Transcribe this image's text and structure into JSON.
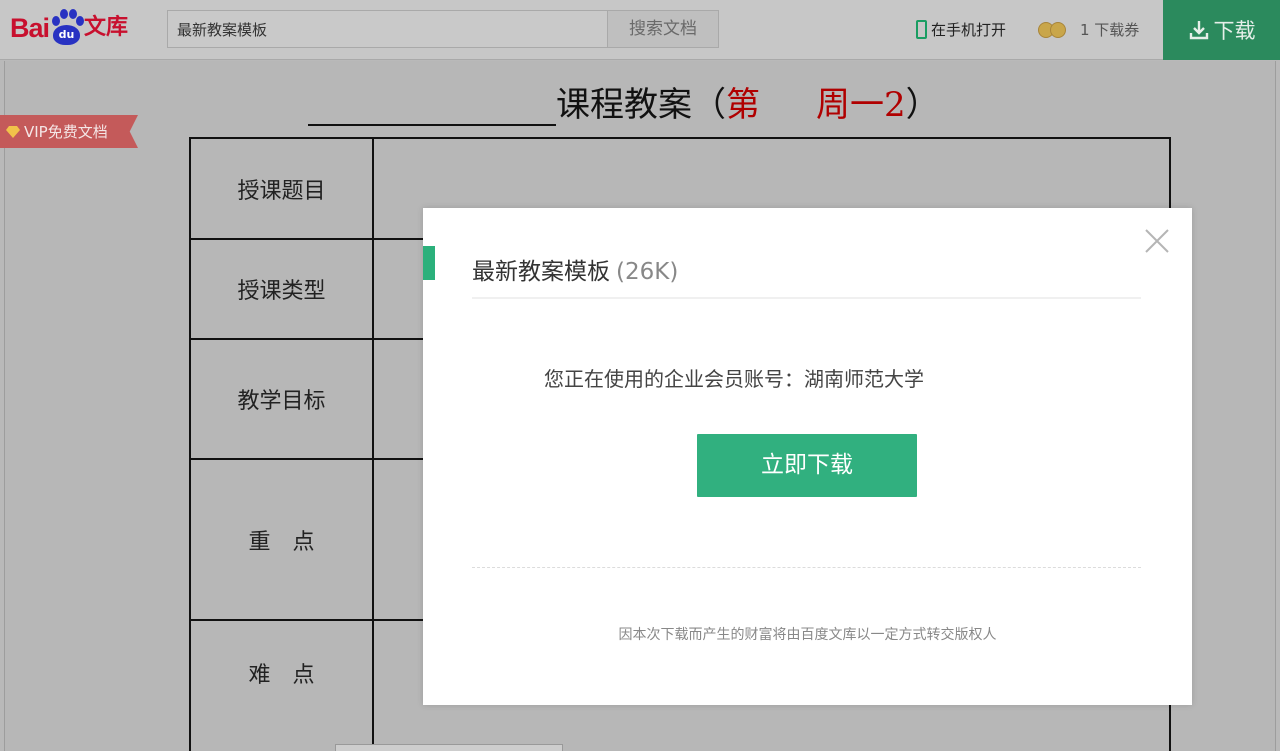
{
  "header": {
    "logo": {
      "bai": "Bai",
      "du": "du",
      "wenku": "文库"
    },
    "search": {
      "value": "最新教案模板",
      "button_label": "搜索文档"
    },
    "mobile_open_label": "在手机打开",
    "coupon_label": "1 下载券",
    "download_label": "下载",
    "accent_color": "#2b8a5d"
  },
  "vip_tag": {
    "label": "VIP免费文档"
  },
  "document": {
    "title_main": "课程教案（",
    "title_week": "第",
    "title_weekday": "周一2",
    "title_close": "）",
    "rows": [
      {
        "label": "授课题目"
      },
      {
        "label": "授课类型"
      },
      {
        "label": "教学目标"
      },
      {
        "label": "重　点"
      },
      {
        "label": "难　点"
      }
    ]
  },
  "modal": {
    "title": "最新教案模板",
    "size": "(26K)",
    "account_text": "您正在使用的企业会员账号：湖南师范大学",
    "download_button": "立即下载",
    "note": "因本次下载而产生的财富将由百度文库以一定方式转交版权人",
    "accent_color": "#2bb07b"
  }
}
